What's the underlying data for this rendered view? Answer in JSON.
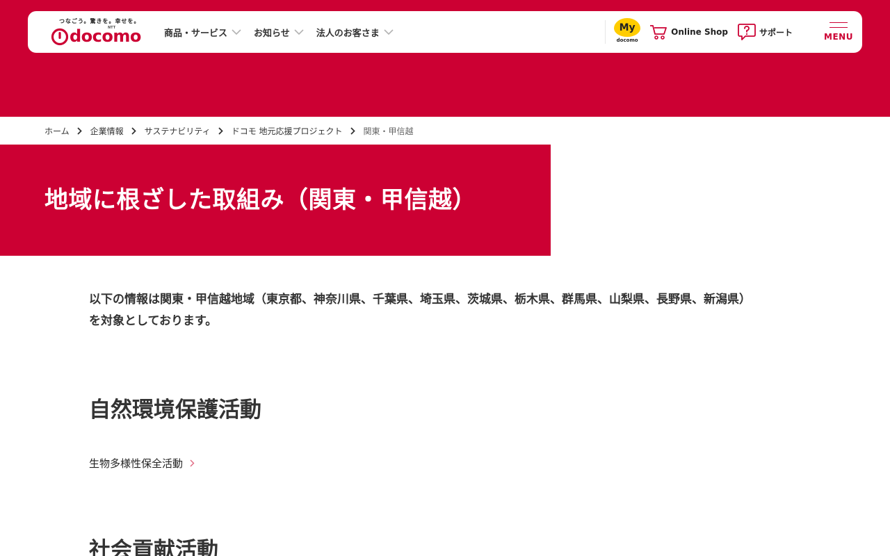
{
  "header": {
    "logo": {
      "tagline": "つなごう。驚きを。幸せを。",
      "ntt": "NTT",
      "wordmark": "docomo"
    },
    "nav": [
      {
        "label": "商品・サービス"
      },
      {
        "label": "お知らせ"
      },
      {
        "label": "法人のお客さま"
      }
    ],
    "mydocomo": {
      "badge": "My",
      "sub": "docomo"
    },
    "online_shop": "Online Shop",
    "support": "サポート",
    "menu": "MENU"
  },
  "breadcrumb": [
    {
      "label": "ホーム"
    },
    {
      "label": "企業情報"
    },
    {
      "label": "サステナビリティ"
    },
    {
      "label": "ドコモ 地元応援プロジェクト"
    },
    {
      "label": "関東・甲信越"
    }
  ],
  "page_title": "地域に根ざした取組み（関東・甲信越）",
  "intro": {
    "line1": "以下の情報は関東・甲信越地域（東京都、神奈川県、千葉県、埼玉県、茨城県、栃木県、群馬県、山梨県、長野県、新潟県）",
    "line2": "を対象としております。"
  },
  "sections": [
    {
      "heading": "自然環境保護活動",
      "links": [
        {
          "label": "生物多様性保全活動"
        }
      ]
    },
    {
      "heading": "社会貢献活動"
    }
  ],
  "colors": {
    "brand_red": "#cc0033",
    "text": "#333333",
    "mydocomo_yellow": "#ffcc00",
    "chevron_gray": "#b3b3b3",
    "link_chevron_pink": "#e0667f"
  }
}
